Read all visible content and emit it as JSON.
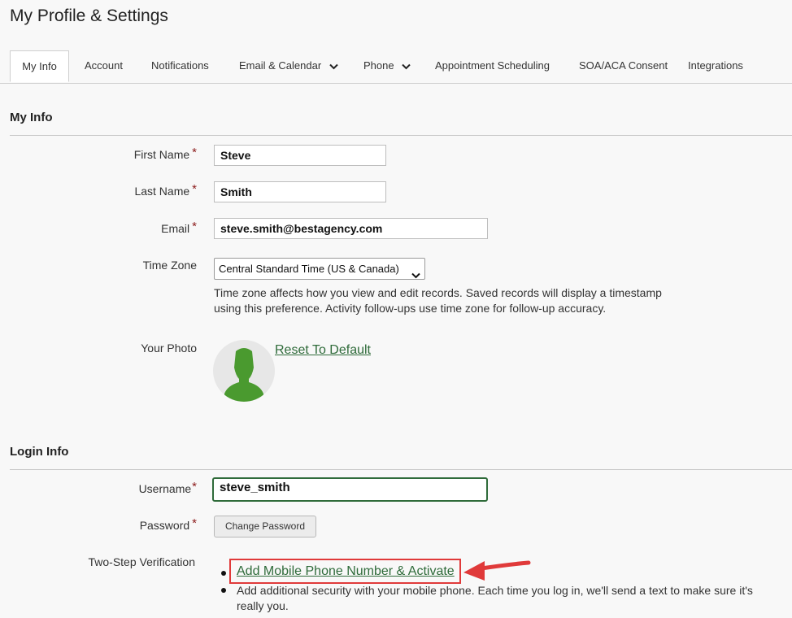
{
  "page": {
    "title": "My Profile & Settings"
  },
  "tabs": [
    {
      "label": "My Info",
      "active": true
    },
    {
      "label": "Account"
    },
    {
      "label": "Notifications"
    },
    {
      "label": "Email & Calendar",
      "dropdown": true
    },
    {
      "label": "Phone",
      "dropdown": true
    },
    {
      "label": "Appointment Scheduling"
    },
    {
      "label": "SOA/ACA Consent"
    },
    {
      "label": "Integrations"
    }
  ],
  "my_info": {
    "section_title": "My Info",
    "first_name": {
      "label": "First Name",
      "required_mark": "*",
      "value": "Steve"
    },
    "last_name": {
      "label": "Last Name",
      "required_mark": "*",
      "value": "Smith"
    },
    "email": {
      "label": "Email",
      "required_mark": "*",
      "value": "steve.smith@bestagency.com"
    },
    "time_zone": {
      "label": "Time Zone",
      "selected": "Central Standard Time (US & Canada)",
      "help_text": "Time zone affects how you view and edit records. Saved records will display a timestamp using this preference. Activity follow-ups use time zone for follow-up accuracy."
    },
    "photo": {
      "label": "Your Photo",
      "reset_link": "Reset To Default"
    }
  },
  "login_info": {
    "section_title": "Login Info",
    "username": {
      "label": "Username",
      "required_mark": "*",
      "value": "steve_smith"
    },
    "password": {
      "label": "Password",
      "required_mark": "*",
      "button": "Change Password"
    },
    "two_step": {
      "label": "Two-Step Verification",
      "activate_link": "Add Mobile Phone Number & Activate",
      "description": "Add additional security with your mobile phone. Each time you log in, we'll send a text to make sure it's really you."
    }
  },
  "colors": {
    "accent_green": "#2f6b3a",
    "required_red": "#8b1a1a",
    "annotation_red": "#e03a3a",
    "avatar_green": "#4a9a2f"
  },
  "icons": {
    "chevron": "chevron-down-icon",
    "avatar": "user-silhouette-icon",
    "annotation": "red-arrow-icon"
  }
}
